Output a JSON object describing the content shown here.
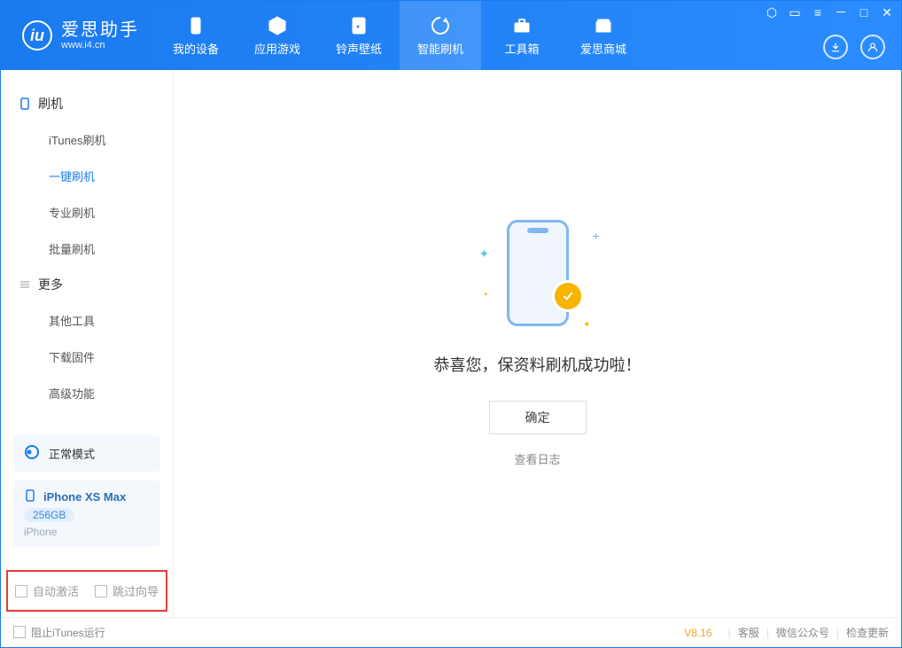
{
  "app": {
    "title": "爱思助手",
    "subtitle": "www.i4.cn"
  },
  "nav": {
    "tabs": [
      {
        "label": "我的设备"
      },
      {
        "label": "应用游戏"
      },
      {
        "label": "铃声壁纸"
      },
      {
        "label": "智能刷机"
      },
      {
        "label": "工具箱"
      },
      {
        "label": "爱思商城"
      }
    ]
  },
  "sidebar": {
    "group1_title": "刷机",
    "group1_items": [
      {
        "label": "iTunes刷机"
      },
      {
        "label": "一键刷机"
      },
      {
        "label": "专业刷机"
      },
      {
        "label": "批量刷机"
      }
    ],
    "group2_title": "更多",
    "group2_items": [
      {
        "label": "其他工具"
      },
      {
        "label": "下载固件"
      },
      {
        "label": "高级功能"
      }
    ]
  },
  "device": {
    "mode": "正常模式",
    "name": "iPhone XS Max",
    "capacity": "256GB",
    "type": "iPhone"
  },
  "options": {
    "auto_activate": "自动激活",
    "skip_guide": "跳过向导"
  },
  "main": {
    "success": "恭喜您，保资料刷机成功啦！",
    "ok": "确定",
    "view_log": "查看日志"
  },
  "footer": {
    "block_itunes": "阻止iTunes运行",
    "version": "V8.16",
    "support": "客服",
    "wechat": "微信公众号",
    "update": "检查更新"
  }
}
